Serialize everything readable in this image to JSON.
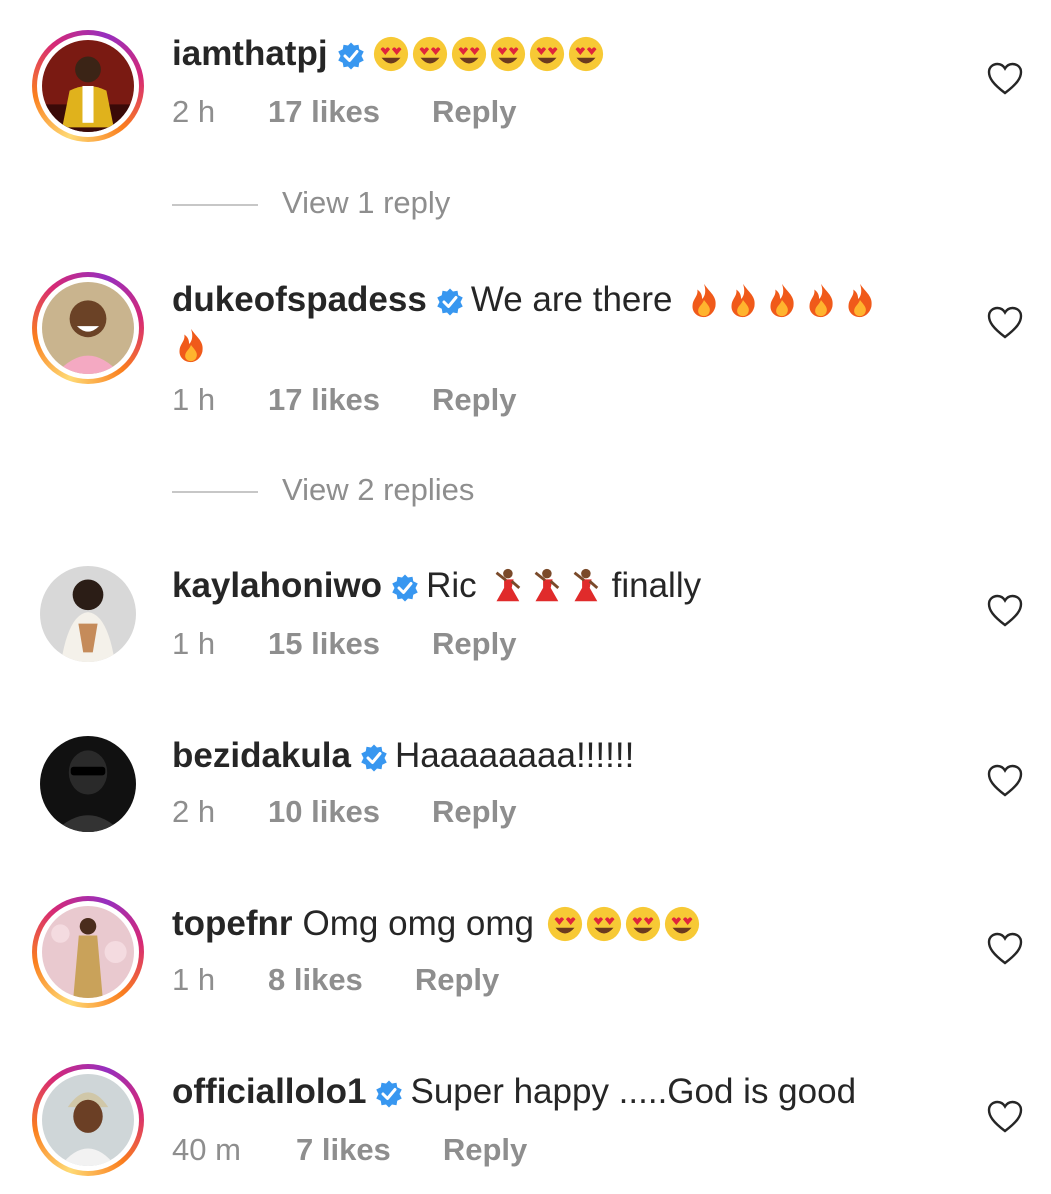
{
  "comments": [
    {
      "username": "iamthatpj",
      "verified": true,
      "text": "",
      "emoji": [
        "heart-eyes",
        "heart-eyes",
        "heart-eyes",
        "heart-eyes",
        "heart-eyes",
        "heart-eyes"
      ],
      "time": "2 h",
      "likes": "17 likes",
      "reply": "Reply",
      "avatar": "person-yellow-jacket",
      "ring": true
    },
    {
      "username": "dukeofspadess",
      "verified": true,
      "text": "We are there",
      "emoji": [
        "fire",
        "fire",
        "fire",
        "fire",
        "fire",
        "fire"
      ],
      "time": "1 h",
      "likes": "17 likes",
      "reply": "Reply",
      "avatar": "person-smiling-pink-shirt",
      "ring": true
    },
    {
      "username": "kaylahoniwo",
      "verified": true,
      "text": "Ric",
      "text_after": "finally",
      "emoji": [
        "dancer",
        "dancer",
        "dancer"
      ],
      "time": "1 h",
      "likes": "15 likes",
      "reply": "Reply",
      "avatar": "person-white-outfit",
      "ring": false
    },
    {
      "username": "bezidakula",
      "verified": true,
      "text": "Haaaaaaaa!!!!!!",
      "emoji": [],
      "time": "2 h",
      "likes": "10 likes",
      "reply": "Reply",
      "avatar": "person-dark-glasses",
      "ring": false
    },
    {
      "username": "topefnr",
      "verified": false,
      "text": "Omg omg omg",
      "emoji": [
        "heart-eyes",
        "heart-eyes",
        "heart-eyes",
        "heart-eyes"
      ],
      "time": "1 h",
      "likes": "8 likes",
      "reply": "Reply",
      "avatar": "person-gold-dress",
      "ring": true
    },
    {
      "username": "officiallolo1",
      "verified": true,
      "text": "Super happy .....God is good",
      "emoji": [],
      "time": "40 m",
      "likes": "7 likes",
      "reply": "Reply",
      "avatar": "person-headwrap",
      "ring": true
    }
  ],
  "view_replies": [
    "View 1 reply",
    "View 2 replies"
  ],
  "icons": {
    "verified": "verified-badge-icon",
    "like": "heart-outline-icon"
  },
  "colors": {
    "verified_blue": "#3897f0",
    "muted_text": "#8e8e8e",
    "text": "#262626"
  }
}
